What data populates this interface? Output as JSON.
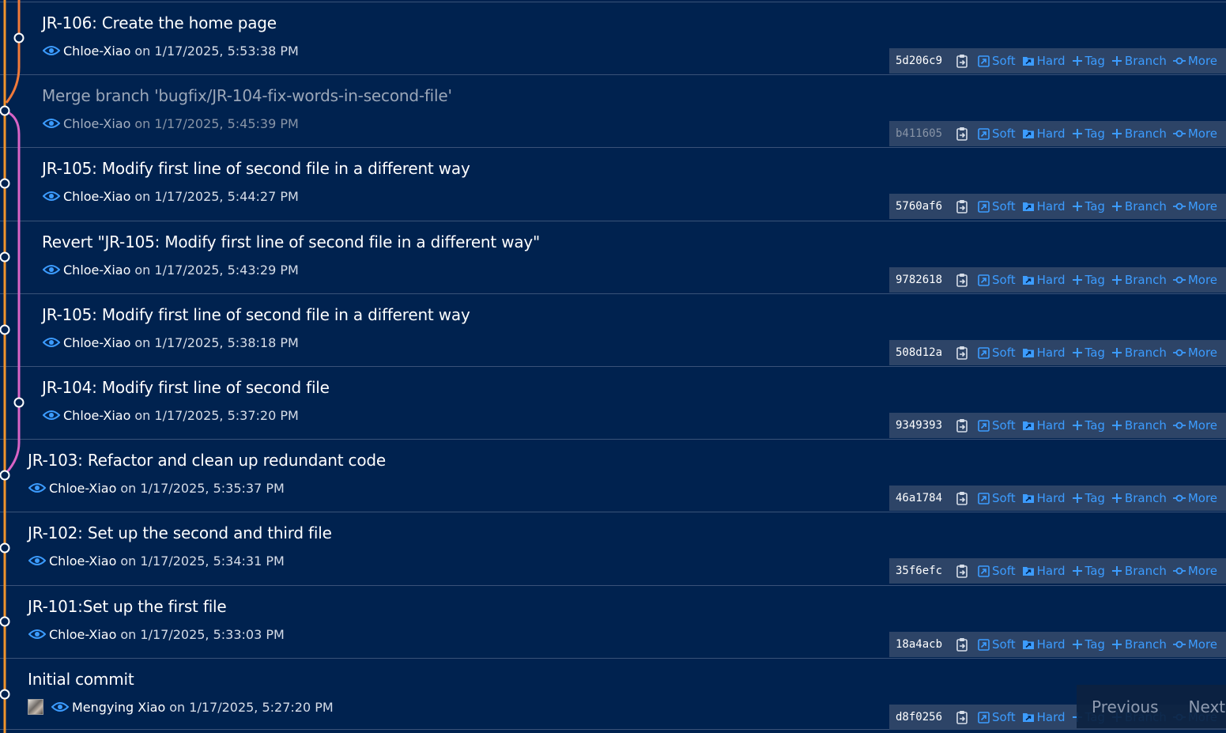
{
  "colors": {
    "background": "#00224f",
    "row_border": "#3a5278",
    "action_bar": "#2d4467",
    "action_link": "#3c9cff",
    "graph_main": "#f0932b",
    "graph_branch_orange": "#f07a3a",
    "graph_branch_pink": "#d964c6"
  },
  "action_labels": {
    "soft": "Soft",
    "hard": "Hard",
    "tag": "Tag",
    "branch": "Branch",
    "more": "More"
  },
  "commits": [
    {
      "title": "JR-106: Create the home page",
      "author": "Chloe-Xiao",
      "date": "on 1/17/2025, 5:53:38 PM",
      "hash": "5d206c9",
      "merge": false
    },
    {
      "title": "Merge branch 'bugfix/JR-104-fix-words-in-second-file'",
      "author": "Chloe-Xiao",
      "date": "on 1/17/2025, 5:45:39 PM",
      "hash": "b411605",
      "merge": true
    },
    {
      "title": "JR-105: Modify first line of second file in a different way",
      "author": "Chloe-Xiao",
      "date": "on 1/17/2025, 5:44:27 PM",
      "hash": "5760af6",
      "merge": false
    },
    {
      "title": "Revert \"JR-105: Modify first line of second file in a different way\"",
      "author": "Chloe-Xiao",
      "date": "on 1/17/2025, 5:43:29 PM",
      "hash": "9782618",
      "merge": false
    },
    {
      "title": "JR-105: Modify first line of second file in a different way",
      "author": "Chloe-Xiao",
      "date": "on 1/17/2025, 5:38:18 PM",
      "hash": "508d12a",
      "merge": false
    },
    {
      "title": "JR-104: Modify first line of second file",
      "author": "Chloe-Xiao",
      "date": "on 1/17/2025, 5:37:20 PM",
      "hash": "9349393",
      "merge": false
    },
    {
      "title": "JR-103: Refactor and clean up redundant code",
      "author": "Chloe-Xiao",
      "date": "on 1/17/2025, 5:35:37 PM",
      "hash": "46a1784",
      "merge": false
    },
    {
      "title": "JR-102: Set up the second and third file",
      "author": "Chloe-Xiao",
      "date": "on 1/17/2025, 5:34:31 PM",
      "hash": "35f6efc",
      "merge": false
    },
    {
      "title": "JR-101:Set up the first file",
      "author": "Chloe-Xiao",
      "date": "on 1/17/2025, 5:33:03 PM",
      "hash": "18a4acb",
      "merge": false
    },
    {
      "title": "Initial commit",
      "author": "Mengying Xiao",
      "date": "on 1/17/2025, 5:27:20 PM",
      "hash": "d8f0256",
      "merge": false,
      "has_avatar": true
    }
  ],
  "pagination": {
    "previous": "Previous",
    "next": "Next"
  }
}
